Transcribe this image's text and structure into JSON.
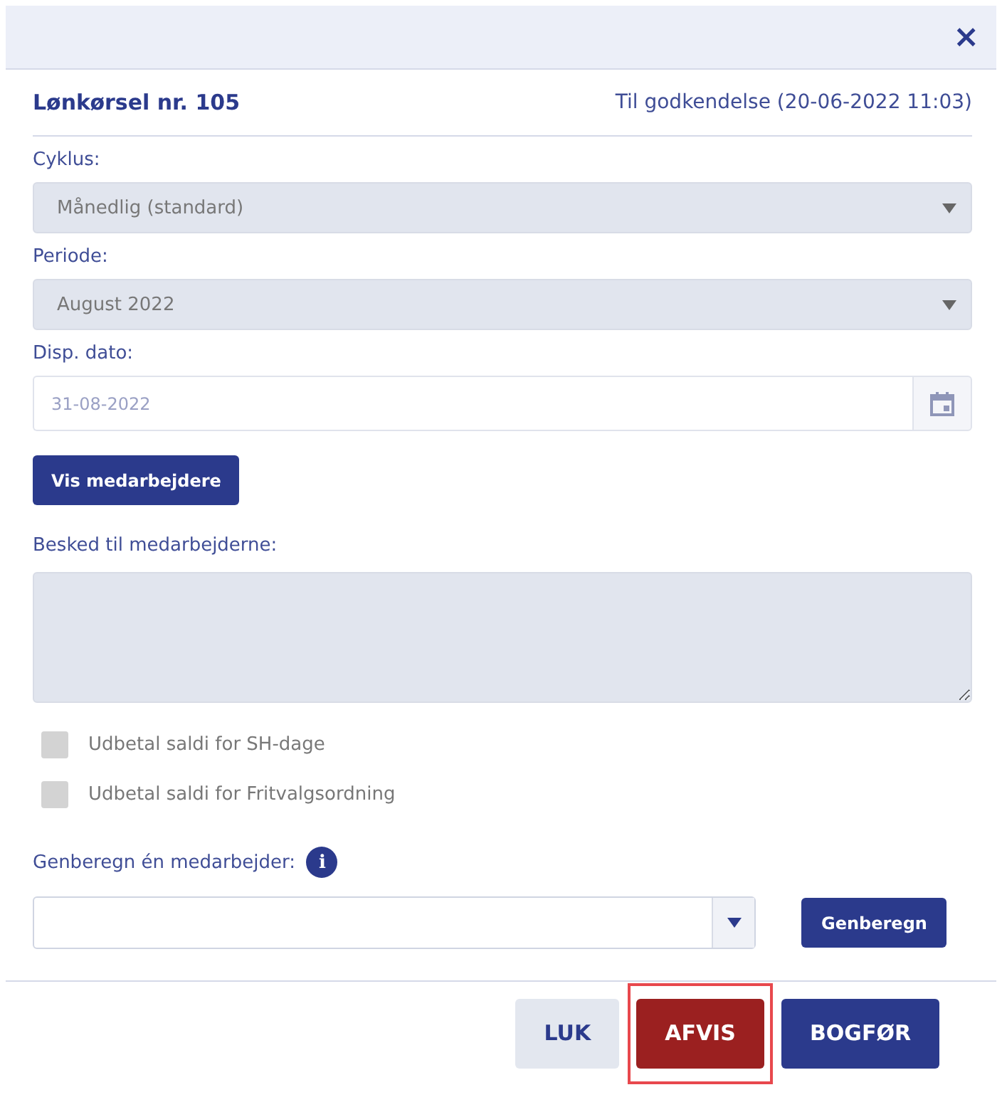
{
  "dialog": {
    "close": "×",
    "title": "Lønkørsel nr. 105",
    "status": "Til godkendelse (20-06-2022 11:03)"
  },
  "fields": [
    {
      "kind": "select",
      "label": "Cyklus:",
      "value": "Månedlig (standard)",
      "disabled": true
    },
    {
      "kind": "select",
      "label": "Periode:",
      "value": "August 2022",
      "disabled": true
    },
    {
      "kind": "date",
      "label": "Disp. dato:",
      "placeholder": "31-08-2022",
      "disabled": false
    }
  ],
  "show_button": "Vis medarbejdere",
  "message": {
    "label": "Besked til medarbejderne:",
    "disabled": true
  },
  "checkboxes": [
    {
      "label": "Udbetal saldi for SH-dage",
      "checked": false,
      "disabled": true
    },
    {
      "label": "Udbetal saldi for Fritvalgsordning",
      "checked": false,
      "disabled": true
    }
  ],
  "recalc": {
    "label": "Genberegn én medarbejder:",
    "info": "i",
    "button": "Genberegn"
  },
  "footer_buttons": [
    {
      "kind": "neutral",
      "label": "LUK",
      "highlighted": false
    },
    {
      "kind": "danger",
      "label": "AFVIS",
      "highlighted": true
    },
    {
      "kind": "primary",
      "label": "BOGFØR",
      "highlighted": false
    }
  ]
}
